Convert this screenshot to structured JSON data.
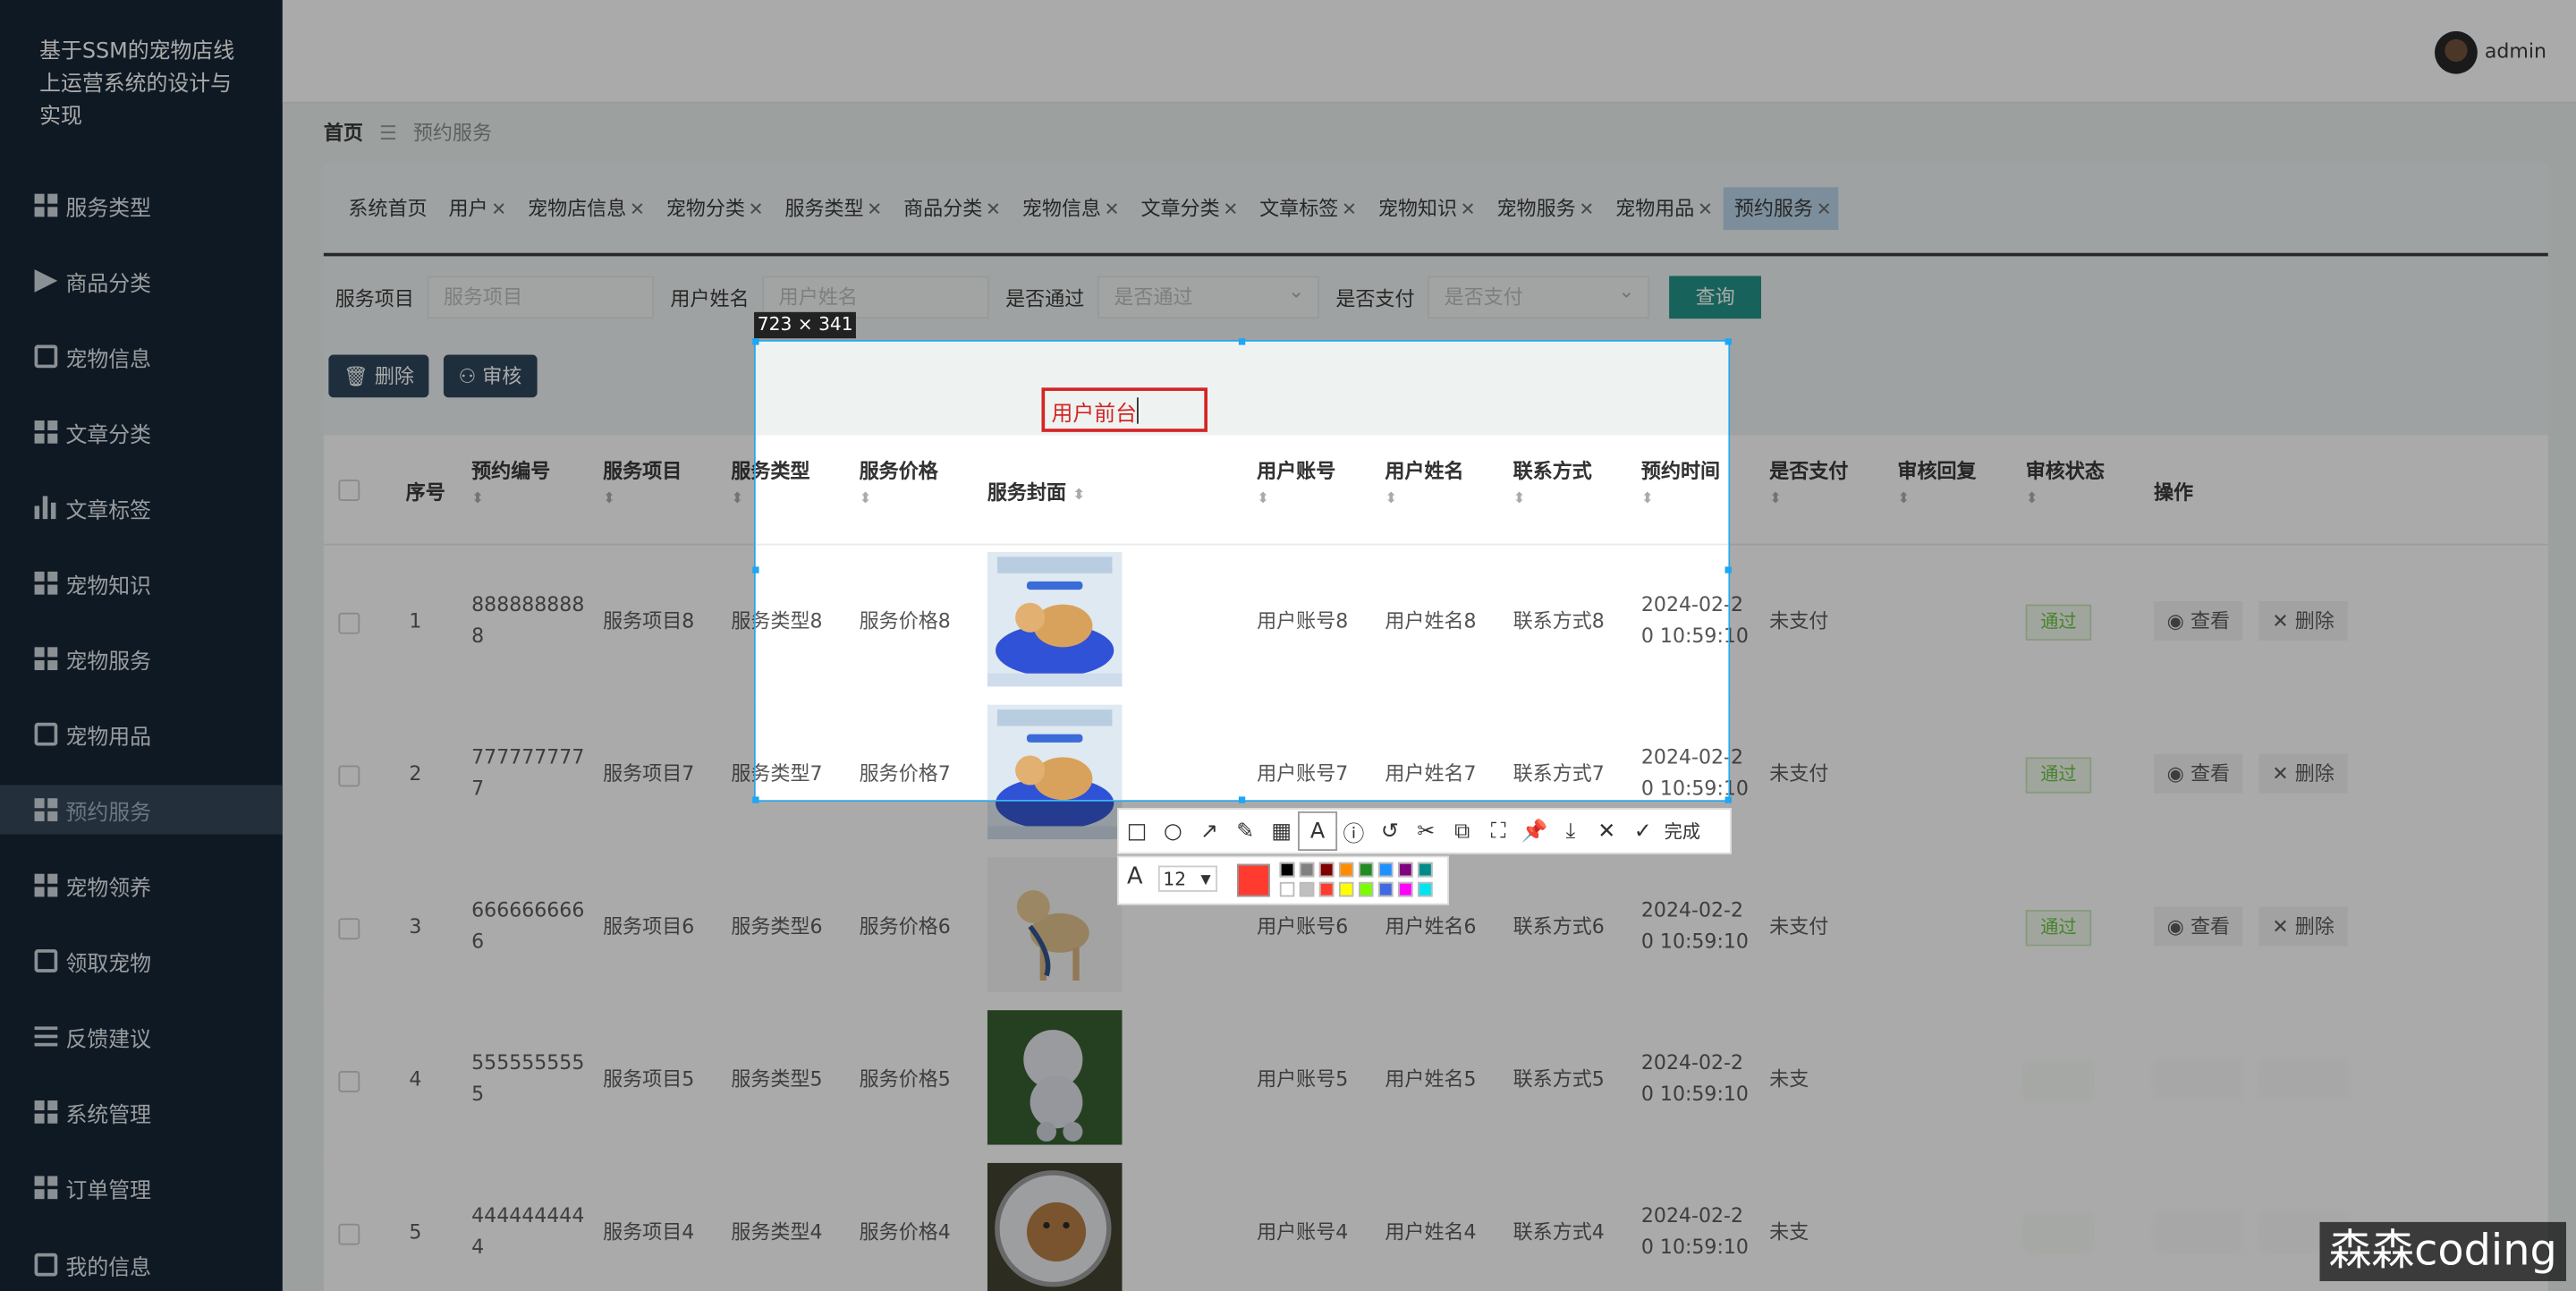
{
  "app_title": "基于SSM的宠物店线上运营系统的设计与实现",
  "user": {
    "name": "admin"
  },
  "sidebar": {
    "items": [
      {
        "label": "服务类型",
        "icon": "grid-icon"
      },
      {
        "label": "商品分类",
        "icon": "send-icon"
      },
      {
        "label": "宠物信息",
        "icon": "briefcase-icon"
      },
      {
        "label": "文章分类",
        "icon": "grid-icon"
      },
      {
        "label": "文章标签",
        "icon": "bar-chart-icon"
      },
      {
        "label": "宠物知识",
        "icon": "grid-icon"
      },
      {
        "label": "宠物服务",
        "icon": "grid-icon"
      },
      {
        "label": "宠物用品",
        "icon": "clipboard-icon"
      },
      {
        "label": "预约服务",
        "icon": "grid-icon"
      },
      {
        "label": "宠物领养",
        "icon": "ticket-icon"
      },
      {
        "label": "领取宠物",
        "icon": "clipboard-icon"
      },
      {
        "label": "反馈建议",
        "icon": "list-icon"
      },
      {
        "label": "系统管理",
        "icon": "grid-icon"
      },
      {
        "label": "订单管理",
        "icon": "grid-icon"
      },
      {
        "label": "我的信息",
        "icon": "card-icon"
      }
    ],
    "active": "预约服务"
  },
  "breadcrumb": {
    "home": "首页",
    "current": "预约服务"
  },
  "tabs": [
    "系统首页",
    "用户",
    "宠物店信息",
    "宠物分类",
    "服务类型",
    "商品分类",
    "宠物信息",
    "文章分类",
    "文章标签",
    "宠物知识",
    "宠物服务",
    "宠物用品",
    "预约服务"
  ],
  "search": {
    "f1_label": "服务项目",
    "f1_placeholder": "服务项目",
    "f2_label": "用户姓名",
    "f2_placeholder": "用户姓名",
    "f3_label": "是否通过",
    "f3_placeholder": "是否通过",
    "f4_label": "是否支付",
    "f4_placeholder": "是否支付",
    "query": "查询"
  },
  "actions": {
    "delete": "删除",
    "audit": "审核"
  },
  "table": {
    "headers": [
      "序号",
      "预约编号",
      "服务项目",
      "服务类型",
      "服务价格",
      "服务封面",
      "用户账号",
      "用户姓名",
      "联系方式",
      "预约时间",
      "是否支付",
      "审核回复",
      "审核状态",
      "操作"
    ],
    "rows": [
      {
        "idx": "1",
        "code1": "888888888",
        "code2": "8",
        "item": "服务项目8",
        "type": "服务类型8",
        "price": "服务价格8",
        "acct": "用户账号8",
        "name": "用户姓名8",
        "contact": "联系方式8",
        "time1": "2024-02-2",
        "time2": "0 10:59:10",
        "paid": "未支付",
        "status": "通过",
        "view": "查看",
        "del": "删除"
      },
      {
        "idx": "2",
        "code1": "777777777",
        "code2": "7",
        "item": "服务项目7",
        "type": "服务类型7",
        "price": "服务价格7",
        "acct": "用户账号7",
        "name": "用户姓名7",
        "contact": "联系方式7",
        "time1": "2024-02-2",
        "time2": "0 10:59:10",
        "paid": "未支付",
        "status": "通过",
        "view": "查看",
        "del": "删除"
      },
      {
        "idx": "3",
        "code1": "666666666",
        "code2": "6",
        "item": "服务项目6",
        "type": "服务类型6",
        "price": "服务价格6",
        "acct": "用户账号6",
        "name": "用户姓名6",
        "contact": "联系方式6",
        "time1": "2024-02-2",
        "time2": "0 10:59:10",
        "paid": "未支付",
        "status": "通过",
        "view": "查看",
        "del": "删除"
      },
      {
        "idx": "4",
        "code1": "555555555",
        "code2": "5",
        "item": "服务项目5",
        "type": "服务类型5",
        "price": "服务价格5",
        "acct": "用户账号5",
        "name": "用户姓名5",
        "contact": "联系方式5",
        "time1": "2024-02-2",
        "time2": "0 10:59:10",
        "paid": "未支",
        "status": "",
        "view": "",
        "del": ""
      },
      {
        "idx": "5",
        "code1": "444444444",
        "code2": "4",
        "item": "服务项目4",
        "type": "服务类型4",
        "price": "服务价格4",
        "acct": "用户账号4",
        "name": "用户姓名4",
        "contact": "联系方式4",
        "time1": "2024-02-2",
        "time2": "0 10:59:10",
        "paid": "未支",
        "status": "",
        "view": "",
        "del": ""
      }
    ]
  },
  "capture": {
    "size_label": "723 × 341",
    "annotation_text": "用户前台",
    "font_size": "12",
    "done_label": "完成",
    "current_color": "#ff3b30",
    "palette": [
      "#000000",
      "#808080",
      "#800000",
      "#ff8c00",
      "#228b22",
      "#1e90ff",
      "#800080",
      "#008b8b",
      "#ffffff",
      "#c0c0c0",
      "#ff3b30",
      "#ffff00",
      "#7cfc00",
      "#4169e1",
      "#ff00ff",
      "#00e5ee"
    ]
  },
  "watermark": "森森coding"
}
